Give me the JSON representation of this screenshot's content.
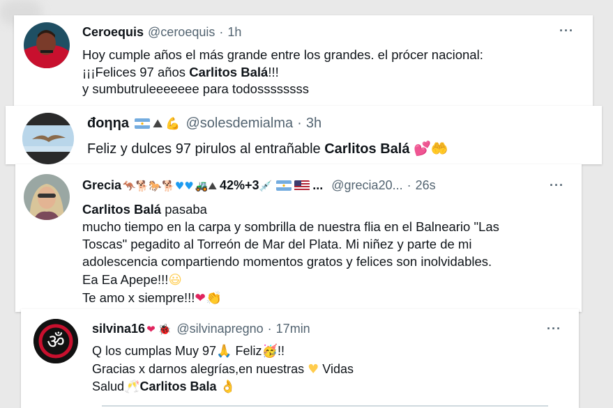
{
  "tweets": [
    {
      "name": "Ceroequis",
      "handle": "@ceroequis",
      "time": "1h",
      "line1": "Hoy cumple años el más grande entre los grandes. el prócer nacional:",
      "line2_pre": "¡¡¡Felices 97 años ",
      "line2_bold": "Carlitos Balá",
      "line2_post": "!!!",
      "line3": "y sumbutruleeeeeee para todossssssss",
      "more": "···"
    },
    {
      "name": "đoηηa",
      "handle": "@solesdemialma",
      "time": "3h",
      "text_pre": "Feliz y dulces 97 pirulos al entrañable ",
      "text_bold": "Carlitos Balá",
      "emoji": "💕🫶"
    },
    {
      "name": "Grecia",
      "name_extra": "42%+3",
      "handle": "@grecia20...",
      "time": "26s",
      "line1_bold": "Carlitos Balá",
      "line1_post": " pasaba",
      "line2": "mucho tiempo en la  carpa y sombrilla de nuestra flia en el Balneario \"Las",
      "line3": "Toscas\" pegadito al Torreón de Mar del Plata. Mi niñez y parte de mi",
      "line4": "adolescencia compartiendo momentos gratos y felices son inolvidables.",
      "line5": "Ea Ea Apepe!!!",
      "line6": "Te amo x siempre!!!",
      "more": "···"
    },
    {
      "name": "silvina16",
      "handle": "@silvinapregno",
      "time": "17min",
      "line1_a": "Q los cumplas Muy 97",
      "line1_b": " Feliz",
      "line1_c": "!!",
      "line2_a": "Gracias x darnos alegrías,en nuestras ",
      "line2_b": " Vidas",
      "line3_a": "Salud",
      "line3_bold": "Carlitos Bala",
      "more": "···"
    }
  ],
  "colors": {
    "text": "#0f1419",
    "muted": "#536471",
    "heart_red": "#e0245e",
    "heart_blue": "#1d9bf0",
    "yellow": "#ffcc4d",
    "flag_blue": "#74acdf"
  }
}
